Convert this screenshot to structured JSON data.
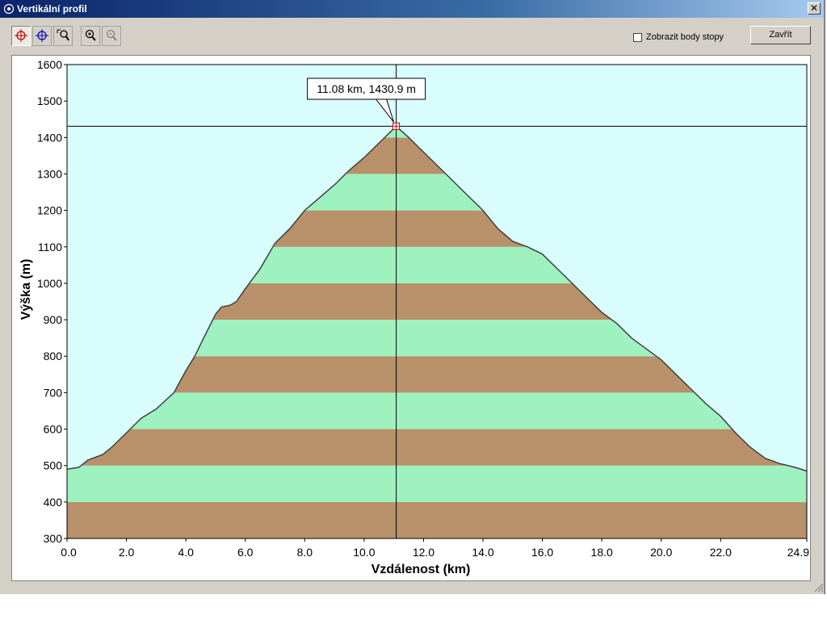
{
  "window": {
    "title": "Vertikální profil",
    "close_glyph": "✕"
  },
  "toolbar": {
    "tools": [
      {
        "name": "crosshair-red-tool",
        "icon": "crosshair-red-icon",
        "active": true
      },
      {
        "name": "crosshair-blue-tool",
        "icon": "crosshair-blue-icon",
        "active": false
      },
      {
        "name": "zoom-region-tool",
        "icon": "zoom-region-icon",
        "active": false
      },
      {
        "name": "zoom-in-tool",
        "icon": "zoom-in-icon",
        "active": false
      },
      {
        "name": "zoom-out-tool",
        "icon": "zoom-out-icon",
        "active": false
      }
    ],
    "show_points_label": "Zobrazit body stopy",
    "show_points_checked": false,
    "close_label": "Zavřít"
  },
  "chart_data": {
    "type": "area",
    "xlabel": "Vzdálenost   (km)",
    "ylabel": "Výška (m)",
    "xlim": [
      0,
      24.9
    ],
    "ylim": [
      300,
      1600
    ],
    "x_ticks": [
      "0.0",
      "2.0",
      "4.0",
      "6.0",
      "8.0",
      "10.0",
      "12.0",
      "14.0",
      "16.0",
      "18.0",
      "20.0",
      "22.0",
      "24.9"
    ],
    "y_ticks": [
      "1600",
      "1500",
      "1400",
      "1300",
      "1200",
      "1100",
      "1000",
      "900",
      "800",
      "700",
      "600",
      "500",
      "400",
      "300"
    ],
    "band_colors": [
      "#b8916a",
      "#9ef2c0"
    ],
    "sky_color": "#d9fcfc",
    "profile": [
      [
        0.0,
        490
      ],
      [
        0.4,
        495
      ],
      [
        0.7,
        515
      ],
      [
        1.2,
        530
      ],
      [
        1.5,
        550
      ],
      [
        2.0,
        590
      ],
      [
        2.5,
        630
      ],
      [
        3.0,
        655
      ],
      [
        3.6,
        700
      ],
      [
        4.0,
        760
      ],
      [
        4.3,
        800
      ],
      [
        4.6,
        850
      ],
      [
        5.0,
        915
      ],
      [
        5.2,
        935
      ],
      [
        5.5,
        940
      ],
      [
        5.7,
        950
      ],
      [
        6.0,
        985
      ],
      [
        6.5,
        1040
      ],
      [
        7.0,
        1110
      ],
      [
        7.5,
        1150
      ],
      [
        8.0,
        1200
      ],
      [
        8.5,
        1235
      ],
      [
        9.0,
        1270
      ],
      [
        9.5,
        1310
      ],
      [
        10.0,
        1345
      ],
      [
        10.5,
        1385
      ],
      [
        11.08,
        1430.9
      ],
      [
        11.5,
        1400
      ],
      [
        12.0,
        1360
      ],
      [
        12.5,
        1320
      ],
      [
        13.0,
        1280
      ],
      [
        13.5,
        1240
      ],
      [
        14.0,
        1200
      ],
      [
        14.5,
        1150
      ],
      [
        15.0,
        1115
      ],
      [
        15.5,
        1100
      ],
      [
        16.0,
        1080
      ],
      [
        16.5,
        1040
      ],
      [
        17.0,
        1000
      ],
      [
        17.5,
        960
      ],
      [
        18.0,
        920
      ],
      [
        18.5,
        890
      ],
      [
        19.0,
        850
      ],
      [
        19.5,
        820
      ],
      [
        20.0,
        790
      ],
      [
        20.5,
        750
      ],
      [
        21.0,
        710
      ],
      [
        21.5,
        670
      ],
      [
        22.0,
        635
      ],
      [
        22.5,
        590
      ],
      [
        23.0,
        550
      ],
      [
        23.5,
        520
      ],
      [
        24.0,
        505
      ],
      [
        24.5,
        495
      ],
      [
        24.9,
        485
      ]
    ],
    "cursor": {
      "x": 11.08,
      "y": 1430.9,
      "label": "11.08 km, 1430.9 m"
    },
    "grid": false
  }
}
